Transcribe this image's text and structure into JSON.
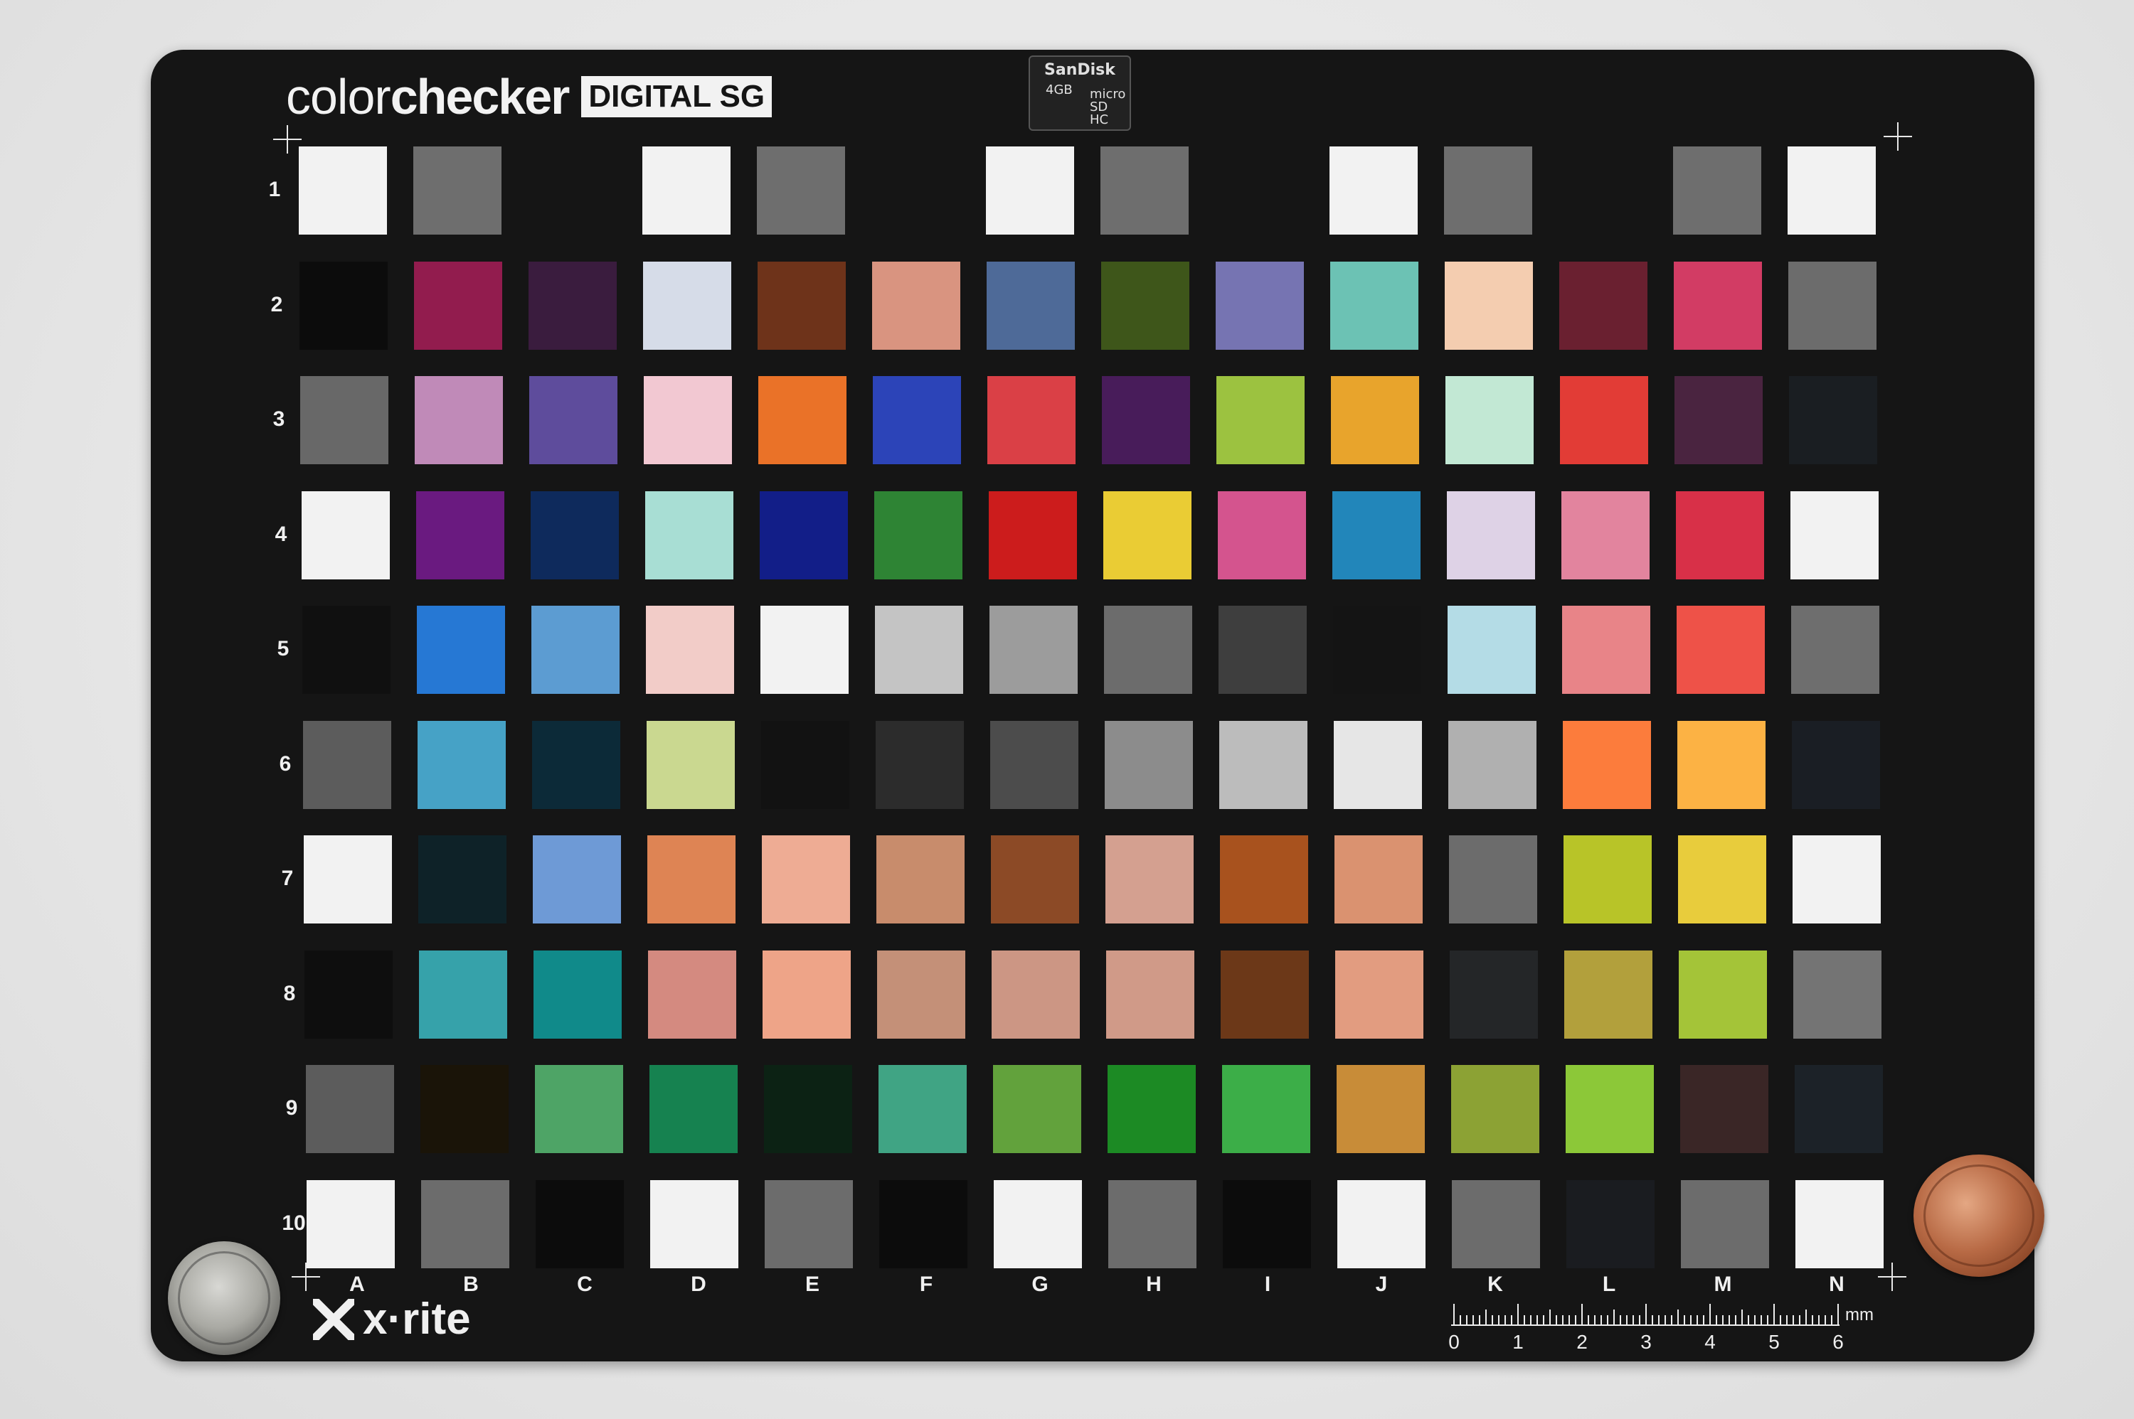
{
  "logo": {
    "word1": "color",
    "word2": "checker",
    "badge": "DIGITAL SG"
  },
  "sdcard": {
    "brand": "SanDisk",
    "capacity": "4GB",
    "type": "micro SD HC"
  },
  "rows": [
    "1",
    "2",
    "3",
    "4",
    "5",
    "6",
    "7",
    "8",
    "9",
    "10"
  ],
  "columns": [
    "A",
    "B",
    "C",
    "D",
    "E",
    "F",
    "G",
    "H",
    "I",
    "J",
    "K",
    "L",
    "M",
    "N"
  ],
  "brand": "x·rite",
  "ruler": {
    "unit": "mm",
    "numbers": [
      "0",
      "1",
      "2",
      "3",
      "4",
      "5",
      "6"
    ]
  },
  "colors": [
    [
      "#f2f2f2",
      "#6e6e6e",
      "#151515",
      "#f2f2f2",
      "#6e6e6e",
      "#151515",
      "#f2f2f2",
      "#6e6e6e",
      "#151515",
      "#f2f2f2",
      "#6e6e6e",
      "#151515",
      "#6e6e6e",
      "#f2f2f2"
    ],
    [
      "#0c0c0c",
      "#921c4e",
      "#3a1c3e",
      "#d6dce8",
      "#6e331a",
      "#d99480",
      "#4e6a98",
      "#3e561a",
      "#7674b2",
      "#6cc2b4",
      "#f4cdb0",
      "#6a2030",
      "#d23c64",
      "#6c6c6c"
    ],
    [
      "#686868",
      "#c08ab8",
      "#5e4c9c",
      "#f2c8d2",
      "#ea7228",
      "#2c44b8",
      "#da4046",
      "#481c5a",
      "#9cc240",
      "#e8a42c",
      "#c2e8d4",
      "#e23c36",
      "#4a2440",
      "#1a1e22"
    ],
    [
      "#f2f2f2",
      "#6a1a80",
      "#0e2a5c",
      "#a8ded4",
      "#121e88",
      "#2e8434",
      "#cc1c1c",
      "#eacc34",
      "#d4548e",
      "#2286ba",
      "#ded2e6",
      "#e2849e",
      "#d83048",
      "#f2f2f2"
    ],
    [
      "#101010",
      "#2678d4",
      "#5c9cd2",
      "#f2ccc8",
      "#f2f2f2",
      "#c4c4c4",
      "#9c9c9c",
      "#6c6c6c",
      "#3e3e3e",
      "#141414",
      "#b4dce6",
      "#e88488",
      "#ee5248",
      "#6e6e6e"
    ],
    [
      "#5c5c5c",
      "#46a2c6",
      "#0c2a38",
      "#cad890",
      "#121212",
      "#2c2c2c",
      "#4c4c4c",
      "#8c8c8c",
      "#bcbcbc",
      "#e6e6e6",
      "#b0b0b0",
      "#fc7c3c",
      "#fcb244",
      "#1a1e24"
    ],
    [
      "#f2f2f2",
      "#0e2228",
      "#6e9ad6",
      "#de8454",
      "#eeac94",
      "#c88c6c",
      "#8c4a26",
      "#d4a090",
      "#a8521e",
      "#da9270",
      "#6c6c6c",
      "#b8c428",
      "#e8cc3c",
      "#f2f2f2"
    ],
    [
      "#0e0e0e",
      "#36a2aa",
      "#108a8a",
      "#d48a80",
      "#eea488",
      "#c49078",
      "#cc9684",
      "#d09a88",
      "#6c3818",
      "#e29c80",
      "#242628",
      "#b2a03c",
      "#a4c438",
      "#747474"
    ],
    [
      "#5c5c5c",
      "#1a1408",
      "#4ea466",
      "#168250",
      "#0c2214",
      "#40a484",
      "#62a23c",
      "#1c8a24",
      "#3cae48",
      "#c88c38",
      "#8ca234",
      "#8cc838",
      "#3a2626",
      "#1c2228"
    ],
    [
      "#f2f2f2",
      "#6c6c6c",
      "#0c0c0c",
      "#f2f2f2",
      "#6c6c6c",
      "#0c0c0c",
      "#f2f2f2",
      "#6c6c6c",
      "#0c0c0c",
      "#f2f2f2",
      "#6c6c6c",
      "#1a1c20",
      "#6c6c6c",
      "#f2f2f2"
    ]
  ]
}
